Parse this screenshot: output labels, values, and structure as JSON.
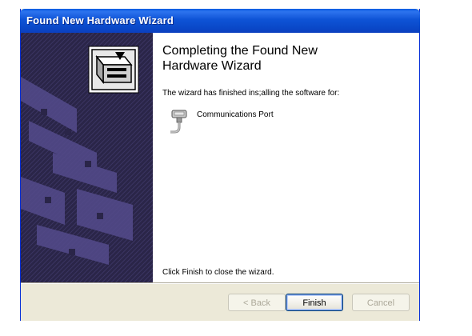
{
  "window": {
    "title": "Found New Hardware Wizard"
  },
  "content": {
    "heading_line1": "Completing the Found New",
    "heading_line2": "Hardware Wizard",
    "subtext": "The wizard has finished ins;alling the software for:",
    "device": {
      "icon": "serial-port-icon",
      "label": "Communications Port"
    },
    "finish_hint": "Click Finish to close the wizard."
  },
  "buttons": {
    "back": "< Back",
    "finish": "Finish",
    "cancel": "Cancel"
  },
  "colors": {
    "titlebar": "#0a48c8",
    "banner": "#2a2548",
    "dialog_face": "#ece9d8"
  }
}
